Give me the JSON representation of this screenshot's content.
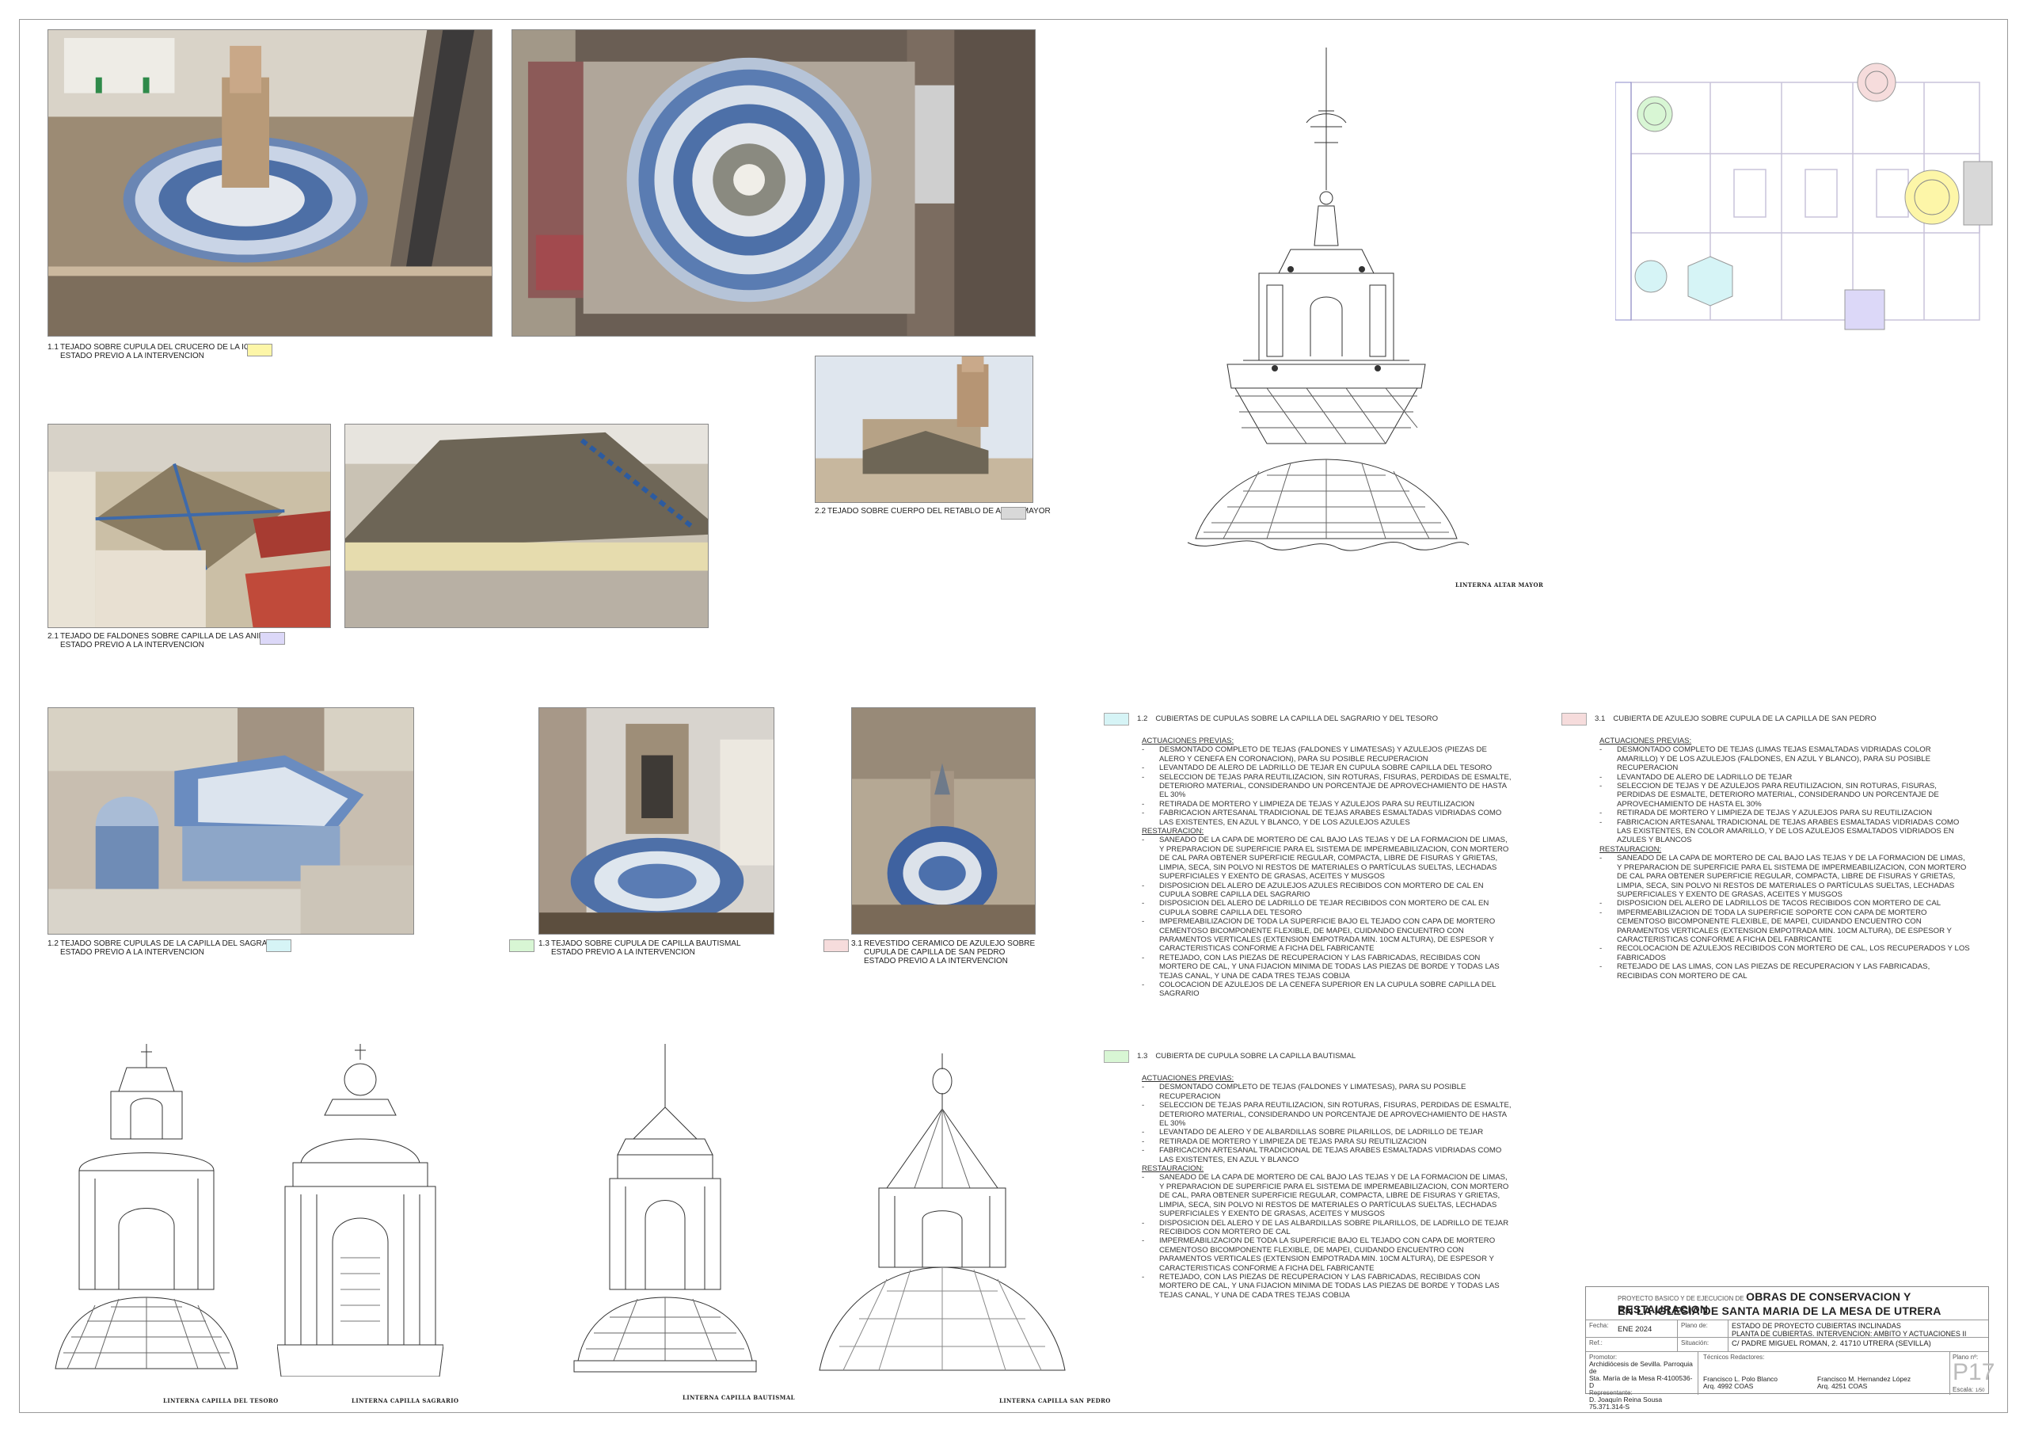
{
  "captions": {
    "c11": {
      "num": "1.1",
      "line1": "TEJADO SOBRE CUPULA DEL CRUCERO DE LA IGLESIA",
      "line2": "ESTADO PREVIO A LA INTERVENCION",
      "color": "#fdf6a8"
    },
    "c21": {
      "num": "2.1",
      "line1": "TEJADO DE FALDONES SOBRE CAPILLA DE LAS ANIMAS",
      "line2": "ESTADO PREVIO A LA INTERVENCION",
      "color": "#dcd8f8"
    },
    "c22": {
      "num": "2.2",
      "line1": "TEJADO SOBRE CUERPO DEL RETABLO DE ALTAR MAYOR",
      "color": "#d8d8d8"
    },
    "c12": {
      "num": "1.2",
      "line1": "TEJADO SOBRE CUPULAS DE LA CAPILLA DEL SAGRARIO",
      "line2": "ESTADO PREVIO A LA INTERVENCION",
      "color": "#d6f4f6"
    },
    "c13": {
      "num": "1.3",
      "line1": "TEJADO SOBRE CUPULA DE CAPILLA BAUTISMAL",
      "line2": "ESTADO PREVIO A LA INTERVENCION",
      "color": "#d8f6d4"
    },
    "c31": {
      "num": "3.1",
      "line1": "REVESTIDO CERAMICO DE AZULEJO SOBRE",
      "line2": "CUPULA DE CAPILLA DE SAN PEDRO",
      "line3": "ESTADO PREVIO A LA INTERVENCION",
      "color": "#f6dcdc"
    }
  },
  "drawing_labels": {
    "altar": "LINTERNA ALTAR MAYOR",
    "tesoro": "LINTERNA CAPILLA DEL TESORO",
    "sagrario": "LINTERNA CAPILLA SAGRARIO",
    "bautismal": "LINTERNA CAPILLA BAUTISMAL",
    "sanpedro": "LINTERNA CAPILLA SAN PEDRO"
  },
  "specs": {
    "s12": {
      "num": "1.2",
      "title": "CUBIERTAS DE CUPULAS SOBRE LA CAPILLA DEL SAGRARIO Y DEL TESORO",
      "color": "#d6f4f6",
      "prev_title": "ACTUACIONES PREVIAS:",
      "prev": [
        "DESMONTADO COMPLETO DE TEJAS (FALDONES Y LIMATESAS) Y AZULEJOS (PIEZAS DE ALERO Y CENEFA EN CORONACION), PARA SU POSIBLE RECUPERACION",
        "LEVANTADO DE ALERO DE LADRILLO DE TEJAR EN CUPULA SOBRE CAPILLA DEL TESORO",
        "SELECCION DE TEJAS PARA REUTILIZACION, SIN ROTURAS, FISURAS, PERDIDAS DE ESMALTE, DETERIORO MATERIAL, CONSIDERANDO UN PORCENTAJE DE APROVECHAMIENTO DE HASTA EL 30%",
        "RETIRADA DE MORTERO Y LIMPIEZA DE TEJAS Y AZULEJOS PARA SU REUTILIZACION",
        "FABRICACION ARTESANAL TRADICIONAL DE TEJAS ARABES ESMALTADAS VIDRIADAS COMO LAS EXISTENTES, EN AZUL Y BLANCO, Y DE LOS AZULEJOS AZULES"
      ],
      "rest_title": "RESTAURACION:",
      "rest": [
        "SANEADO DE LA CAPA DE MORTERO DE CAL BAJO LAS TEJAS Y DE LA FORMACION DE LIMAS, Y PREPARACION DE SUPERFICIE PARA EL SISTEMA DE IMPERMEABILIZACION, CON MORTERO DE CAL PARA OBTENER SUPERFICIE REGULAR, COMPACTA, LIBRE DE FISURAS Y GRIETAS, LIMPIA, SECA, SIN POLVO NI RESTOS DE MATERIALES O PARTÍCULAS SUELTAS, LECHADAS SUPERFICIALES Y EXENTO DE GRASAS, ACEITES Y MUSGOS",
        "DISPOSICION DEL ALERO DE AZULEJOS AZULES RECIBIDOS CON MORTERO DE CAL EN CUPULA SOBRE CAPILLA DEL SAGRARIO",
        "DISPOSICION DEL ALERO DE LADRILLO DE TEJAR RECIBIDOS CON MORTERO DE CAL EN CUPULA SOBRE CAPILLA DEL TESORO",
        "IMPERMEABILIZACION DE TODA LA SUPERFICIE BAJO EL TEJADO CON CAPA DE MORTERO CEMENTOSO BICOMPONENTE FLEXIBLE, DE MAPEI, CUIDANDO ENCUENTRO CON PARAMENTOS VERTICALES (EXTENSION EMPOTRADA MIN. 10CM ALTURA), DE ESPESOR Y CARACTERISTICAS CONFORME A FICHA DEL FABRICANTE",
        "RETEJADO, CON LAS PIEZAS DE RECUPERACION Y LAS FABRICADAS, RECIBIDAS CON MORTERO DE CAL, Y UNA FIJACION MINIMA DE TODAS LAS PIEZAS DE BORDE Y TODAS LAS TEJAS CANAL, Y UNA DE CADA TRES TEJAS COBIJA",
        "COLOCACION DE AZULEJOS DE LA CENEFA SUPERIOR EN LA CUPULA SOBRE CAPILLA DEL SAGRARIO"
      ]
    },
    "s31": {
      "num": "3.1",
      "title": "CUBIERTA DE AZULEJO SOBRE CUPULA DE LA CAPILLA DE SAN PEDRO",
      "color": "#f6dcdc",
      "prev_title": "ACTUACIONES PREVIAS:",
      "prev": [
        "DESMONTADO COMPLETO DE TEJAS (LIMAS TEJAS ESMALTADAS VIDRIADAS COLOR AMARILLO) Y DE LOS AZULEJOS (FALDONES, EN AZUL Y BLANCO), PARA SU POSIBLE RECUPERACION",
        "LEVANTADO DE ALERO DE LADRILLO DE TEJAR",
        "SELECCION DE TEJAS Y DE AZULEJOS PARA REUTILIZACION, SIN ROTURAS, FISURAS, PERDIDAS DE ESMALTE, DETERIORO MATERIAL, CONSIDERANDO UN PORCENTAJE DE APROVECHAMIENTO DE HASTA EL 30%",
        "RETIRADA DE MORTERO Y LIMPIEZA DE TEJAS Y AZULEJOS PARA SU REUTILIZACION",
        "FABRICACION ARTESANAL TRADICIONAL DE TEJAS ARABES ESMALTADAS VIDRIADAS COMO LAS EXISTENTES, EN COLOR AMARILLO, Y DE LOS AZULEJOS ESMALTADOS VIDRIADOS EN AZULES Y BLANCOS"
      ],
      "rest_title": "RESTAURACION:",
      "rest": [
        "SANEADO DE LA CAPA DE MORTERO DE CAL BAJO LAS TEJAS Y DE LA FORMACION DE LIMAS, Y PREPARACION DE SUPERFICIE PARA EL SISTEMA DE IMPERMEABILIZACION, CON MORTERO DE CAL PARA OBTENER SUPERFICIE REGULAR, COMPACTA, LIBRE DE FISURAS Y GRIETAS, LIMPIA, SECA, SIN POLVO NI RESTOS DE MATERIALES O PARTÍCULAS SUELTAS, LECHADAS SUPERFICIALES Y EXENTO DE GRASAS, ACEITES Y MUSGOS",
        "DISPOSICION DEL ALERO DE LADRILLOS DE TACOS RECIBIDOS CON MORTERO DE CAL",
        "IMPERMEABILIZACION DE TODA LA SUPERFICIE SOPORTE CON CAPA DE MORTERO CEMENTOSO BICOMPONENTE FLEXIBLE, DE MAPEI, CUIDANDO ENCUENTRO CON PARAMENTOS VERTICALES (EXTENSION EMPOTRADA MIN. 10CM ALTURA), DE ESPESOR Y CARACTERISTICAS CONFORME A FICHA DEL FABRICANTE",
        "RECOLOCACION DE AZULEJOS RECIBIDOS CON MORTERO DE CAL, LOS RECUPERADOS Y LOS FABRICADOS",
        "RETEJADO DE LAS LIMAS, CON LAS PIEZAS DE RECUPERACION Y LAS FABRICADAS, RECIBIDAS CON MORTERO DE CAL"
      ]
    },
    "s13": {
      "num": "1.3",
      "title": "CUBIERTA DE CUPULA SOBRE LA CAPILLA BAUTISMAL",
      "color": "#d8f6d4",
      "prev_title": "ACTUACIONES PREVIAS:",
      "prev": [
        "DESMONTADO COMPLETO DE TEJAS (FALDONES Y LIMATESAS), PARA SU POSIBLE RECUPERACION",
        "SELECCION DE TEJAS PARA REUTILIZACION, SIN ROTURAS, FISURAS, PERDIDAS DE ESMALTE, DETERIORO MATERIAL, CONSIDERANDO UN PORCENTAJE DE APROVECHAMIENTO DE HASTA EL 30%",
        "LEVANTADO DE ALERO Y DE ALBARDILLAS SOBRE PILARILLOS, DE LADRILLO DE TEJAR",
        "RETIRADA DE MORTERO Y LIMPIEZA DE TEJAS PARA SU REUTILIZACION",
        "FABRICACION ARTESANAL TRADICIONAL DE TEJAS ARABES ESMALTADAS VIDRIADAS COMO LAS EXISTENTES, EN AZUL Y BLANCO"
      ],
      "rest_title": "RESTAURACION:",
      "rest": [
        "SANEADO DE LA CAPA DE MORTERO DE CAL BAJO LAS TEJAS Y DE LA FORMACION DE LIMAS, Y PREPARACION DE SUPERFICIE PARA EL SISTEMA DE IMPERMEABILIZACION, CON MORTERO DE CAL, PARA OBTENER SUPERFICIE REGULAR, COMPACTA, LIBRE DE FISURAS Y GRIETAS, LIMPIA, SECA, SIN POLVO NI RESTOS DE MATERIALES O PARTÍCULAS SUELTAS, LECHADAS SUPERFICIALES Y EXENTO DE GRASAS, ACEITES Y MUSGOS",
        "DISPOSICION DEL ALERO Y DE LAS ALBARDILLAS SOBRE PILARILLOS, DE LADRILLO DE TEJAR RECIBIDOS CON MORTERO DE CAL",
        "IMPERMEABILIZACION DE TODA LA SUPERFICIE BAJO EL TEJADO CON CAPA DE MORTERO CEMENTOSO BICOMPONENTE FLEXIBLE, DE MAPEI, CUIDANDO ENCUENTRO CON PARAMENTOS VERTICALES (EXTENSION EMPOTRADA MIN. 10CM ALTURA), DE ESPESOR Y CARACTERISTICAS CONFORME A FICHA DEL FABRICANTE",
        "RETEJADO, CON LAS PIEZAS DE RECUPERACION Y LAS FABRICADAS, RECIBIDAS CON MORTERO DE CAL, Y UNA FIJACION MINIMA DE TODAS LAS PIEZAS DE BORDE Y TODAS LAS TEJAS CANAL, Y UNA DE CADA TRES TEJAS COBIJA"
      ]
    }
  },
  "titleblock": {
    "pre": "PROYECTO BASICO Y DE EJECUCION DE",
    "title1": "OBRAS DE CONSERVACION Y RESTAURACION",
    "title2": "EN LA IGLESIA DE SANTA MARIA DE LA MESA DE UTRERA",
    "fecha_label": "Fecha:",
    "fecha": "ENE 2024",
    "plano_label": "Plano de:",
    "plano_line1": "ESTADO DE PROYECTO    CUBIERTAS INCLINADAS",
    "plano_line2": "PLANTA DE CUBIERTAS. INTERVENCION: AMBITO Y ACTUACIONES II",
    "ref_label": "Ref.:",
    "situacion_label": "Situación:",
    "situacion": "C/ PADRE MIGUEL ROMAN, 2.  41710 UTRERA (SEVILLA)",
    "promotor_label": "Promotor:",
    "promotor1": "Archidiócesis de Sevilla. Parroquia de",
    "promotor2": "Sta. María de la Mesa  R-4100536-D",
    "representante_label": "Representante:",
    "representante1": "D. Joaquín Reina Sousa",
    "representante2": "75.371.314-S",
    "tecnicos_label": "Técnicos Redactores:",
    "tecnico1_name": "Francisco L. Polo Blanco",
    "tecnico1_arq": "Arq. 4992 COAS",
    "tecnico2_name": "Francisco M. Hernandez López",
    "tecnico2_arq": "Arq. 4251 COAS",
    "plano_no_label": "Plano nº:",
    "plano_no": "P17",
    "escala_label": "Escala:",
    "escala": "1/50"
  }
}
